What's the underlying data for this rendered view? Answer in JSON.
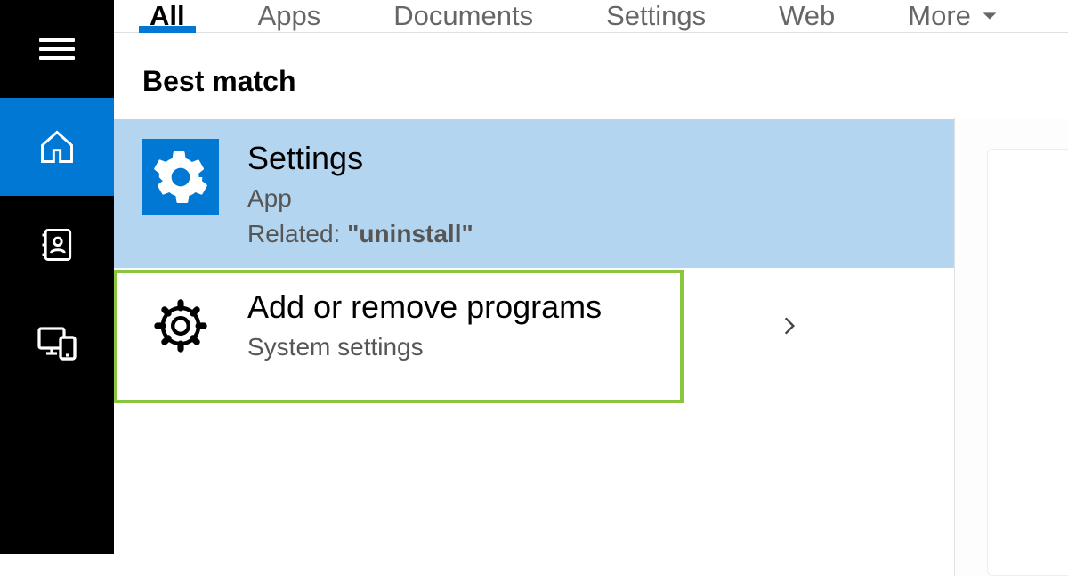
{
  "sidebar": {
    "items": [
      {
        "name": "hamburger-menu"
      },
      {
        "name": "home",
        "active": true
      },
      {
        "name": "contacts"
      },
      {
        "name": "devices"
      }
    ]
  },
  "tabs": {
    "items": [
      {
        "label": "All",
        "active": true
      },
      {
        "label": "Apps"
      },
      {
        "label": "Documents"
      },
      {
        "label": "Settings"
      },
      {
        "label": "Web"
      }
    ],
    "more_label": "More"
  },
  "content": {
    "best_match_label": "Best match",
    "results": [
      {
        "title": "Settings",
        "subtitle": "App",
        "related_prefix": "Related: ",
        "related_value": "\"uninstall\"",
        "icon": "gear-icon",
        "selected": true
      },
      {
        "title": "Add or remove programs",
        "subtitle": "System settings",
        "icon": "gear-icon",
        "highlighted": true
      }
    ]
  }
}
